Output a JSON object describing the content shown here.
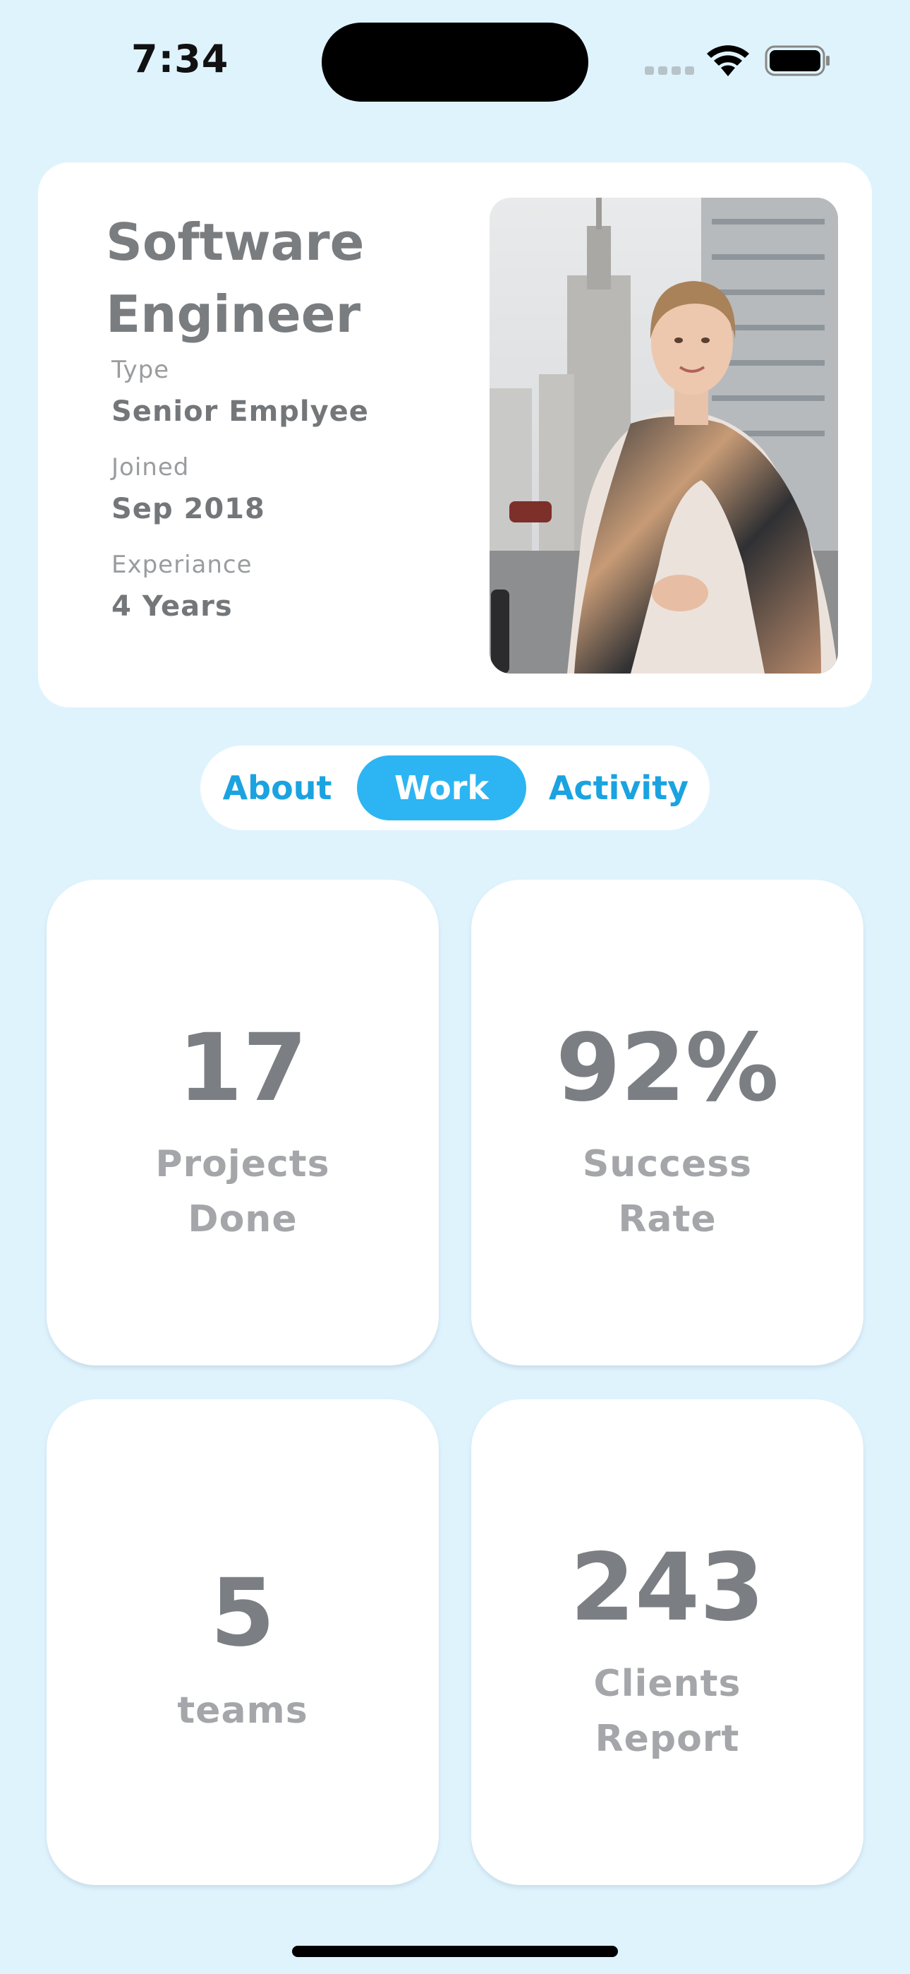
{
  "status_bar": {
    "time": "7:34"
  },
  "profile": {
    "title": "Software Engineer",
    "fields": [
      {
        "label": "Type",
        "value": "Senior Emplyee"
      },
      {
        "label": "Joined",
        "value": "Sep 2018"
      },
      {
        "label": "Experiance",
        "value": "4 Years"
      }
    ]
  },
  "tabs": [
    {
      "label": "About",
      "active": false
    },
    {
      "label": "Work",
      "active": true
    },
    {
      "label": "Activity",
      "active": false
    }
  ],
  "stats": [
    {
      "value": "17",
      "label": "Projects Done"
    },
    {
      "value": "92%",
      "label": "Success Rate"
    },
    {
      "value": "5",
      "label": "teams"
    },
    {
      "value": "243",
      "label": "Clients Report"
    }
  ],
  "colors": {
    "background": "#dff3fd",
    "accent": "#2cb5f2",
    "tab_text": "#1aa3e0",
    "card": "#ffffff"
  }
}
